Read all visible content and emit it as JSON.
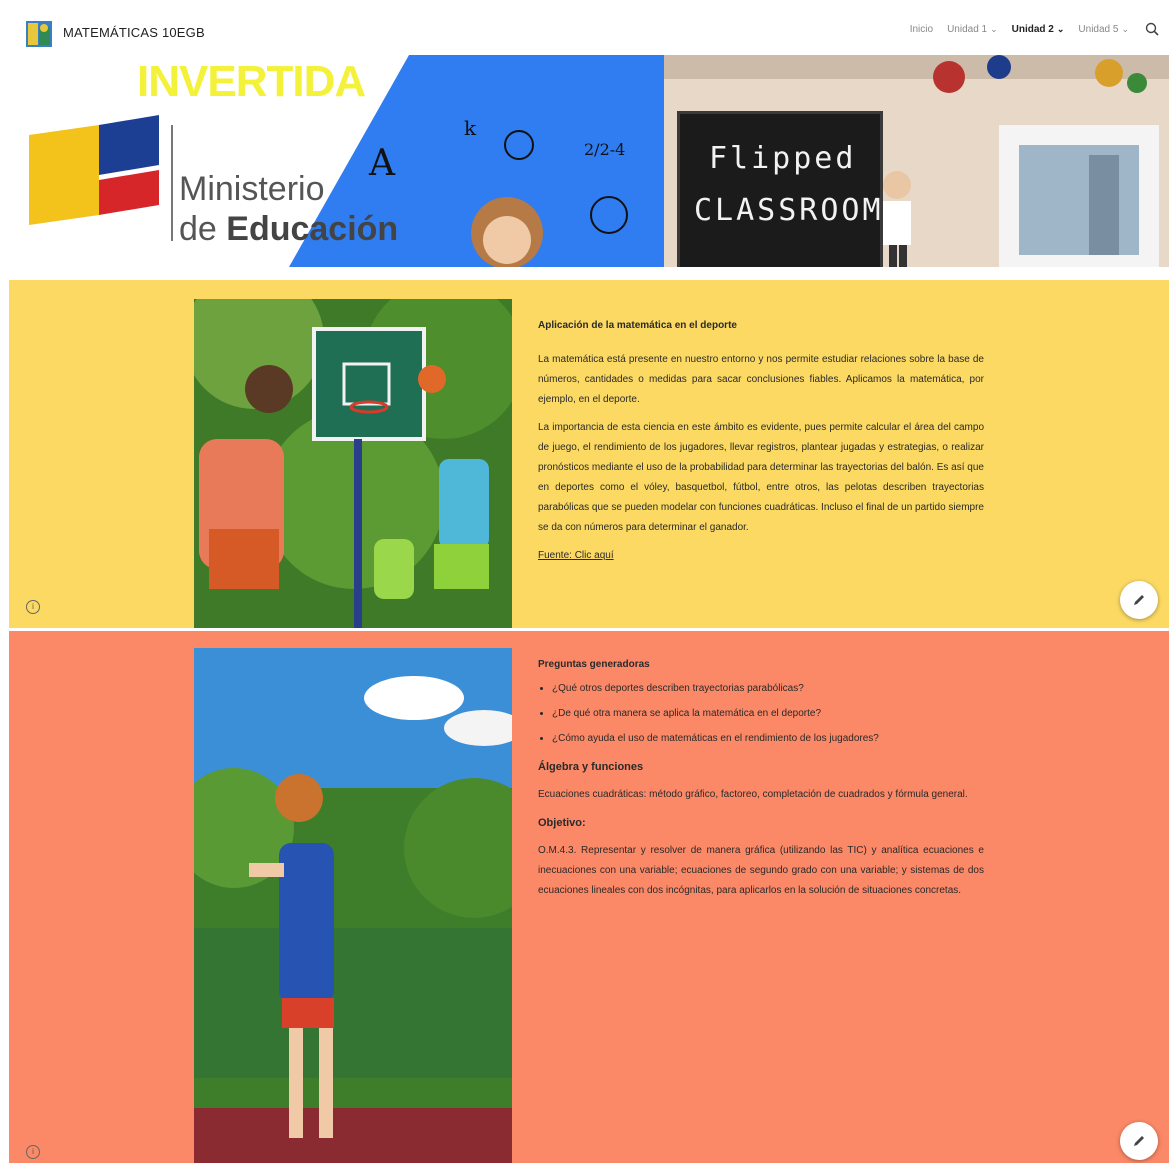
{
  "header": {
    "site_title": "MATEMÁTICAS 10EGB",
    "nav": [
      {
        "label": "Inicio",
        "has_menu": false,
        "active": false
      },
      {
        "label": "Unidad 1",
        "has_menu": true,
        "active": false
      },
      {
        "label": "Unidad 2",
        "has_menu": true,
        "active": true
      },
      {
        "label": "Unidad 5",
        "has_menu": true,
        "active": false
      }
    ],
    "icons": {
      "logo": "site-logo-icon",
      "search": "search-icon",
      "chevron": "chevron-down-icon"
    }
  },
  "banner": {
    "invertida": "INVERTIDA",
    "ministerio_line1": "Ministerio",
    "ministerio_line2_a": "de ",
    "ministerio_line2_b": "Educación",
    "board_line1": "Flipped",
    "board_line2": "CLASSROOM"
  },
  "section1": {
    "heading": "Aplicación de la matemática en el deporte",
    "p1": "La matemática está presente en nuestro entorno y nos permite estudiar relaciones sobre la base de números, cantidades o medidas para sacar conclusiones fiables. Aplicamos la matemática, por ejemplo, en el deporte.",
    "p2": "La importancia de esta ciencia en este ámbito es evidente, pues permite calcular el área del campo de juego, el rendimiento de los jugadores, llevar registros, plantear jugadas y estrategias, o realizar pronósticos mediante el uso de la probabilidad para determinar las trayectorias del balón. Es así que en deportes como el vóley, basquetbol, fútbol, entre otros, las pelotas describen trayectorias parabólicas que se pueden modelar con funciones cuadráticas. Incluso el final de un partido siempre se da con números para determinar el ganador.",
    "source_link": "Fuente: Clic aquí",
    "colors": {
      "background": "#fbd963"
    }
  },
  "section2": {
    "heading": "Preguntas generadoras",
    "questions": [
      "¿Qué otros deportes describen trayectorias parabólicas?",
      "¿De qué otra manera se aplica la matemática en el deporte?",
      "¿Cómo ayuda el uso de matemáticas en el rendimiento de los jugadores?"
    ],
    "topic_title": "Álgebra y funciones",
    "topic_text": "Ecuaciones cuadráticas: método gráfico, factoreo, completación de cuadrados y fórmula general.",
    "objective_title": "Objetivo:",
    "objective_text": "O.M.4.3. Representar y resolver de manera gráfica (utilizando las TIC) y analítica ecuaciones e inecuaciones con una variable; ecuaciones de segundo grado con una variable; y sistemas de dos ecuaciones lineales con dos incógnitas, para aplicarlos en la solución de situaciones concretas.",
    "colors": {
      "background": "#fb8866"
    }
  },
  "controls": {
    "info_icon": "info-icon",
    "edit_icon": "pencil-icon",
    "info_glyph": "i"
  }
}
